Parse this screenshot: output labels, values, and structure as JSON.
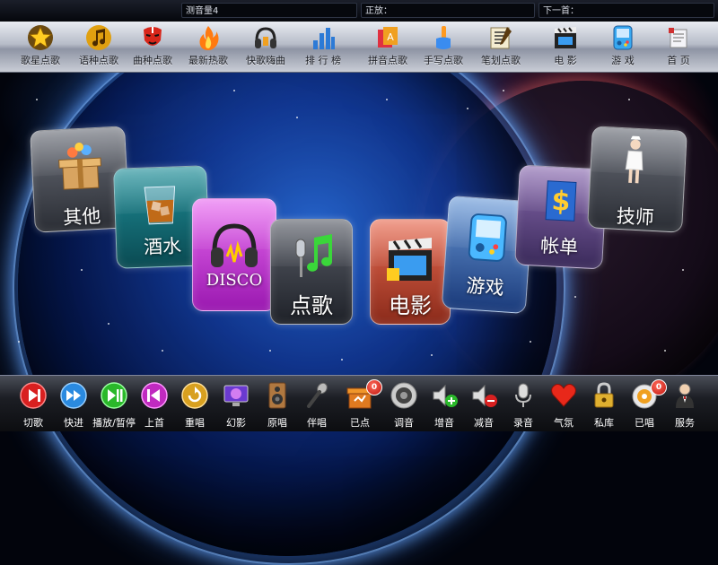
{
  "infobar": {
    "volume_text": "测音量4",
    "now_playing_label": "正放：",
    "next_label": "下一首："
  },
  "topnav": {
    "items": [
      {
        "label": "歌星点歌",
        "icon": "star-icon"
      },
      {
        "label": "语种点歌",
        "icon": "music-note-icon"
      },
      {
        "label": "曲种点歌",
        "icon": "opera-mask-icon"
      },
      {
        "label": "最新热歌",
        "icon": "flame-icon"
      },
      {
        "label": "快歌嗨曲",
        "icon": "headphones-icon"
      },
      {
        "label": "排 行 榜",
        "icon": "bar-chart-icon"
      },
      {
        "label": "拼音点歌",
        "icon": "letter-blocks-icon"
      },
      {
        "label": "手写点歌",
        "icon": "hand-pen-icon"
      },
      {
        "label": "笔划点歌",
        "icon": "brush-script-icon"
      },
      {
        "label": "电 影",
        "icon": "clapperboard-icon"
      },
      {
        "label": "游 戏",
        "icon": "gamepad-icon"
      },
      {
        "label": "首 页",
        "icon": "home-icon"
      }
    ]
  },
  "tiles": {
    "other": "其他",
    "drinks": "酒水",
    "disco": "DISCO",
    "songs": "点歌",
    "movies": "电影",
    "games": "游戏",
    "bill": "帐单",
    "technician": "技师"
  },
  "bottombar": {
    "items": [
      {
        "label": "切歌",
        "icon": "skip-icon"
      },
      {
        "label": "快进",
        "icon": "fast-forward-icon"
      },
      {
        "label": "播放/暂停",
        "icon": "play-pause-icon"
      },
      {
        "label": "上首",
        "icon": "previous-icon"
      },
      {
        "label": "重唱",
        "icon": "replay-icon"
      },
      {
        "label": "幻影",
        "icon": "screen-icon"
      },
      {
        "label": "原唱",
        "icon": "speaker-icon"
      },
      {
        "label": "伴唱",
        "icon": "microphone-icon"
      },
      {
        "label": "已点",
        "icon": "selected-songs-icon",
        "badge": "0"
      },
      {
        "label": "调音",
        "icon": "tuning-speaker-icon"
      },
      {
        "label": "增音",
        "icon": "volume-up-icon"
      },
      {
        "label": "减音",
        "icon": "volume-down-icon"
      },
      {
        "label": "录音",
        "icon": "record-mic-icon"
      },
      {
        "label": "气氛",
        "icon": "heart-icon"
      },
      {
        "label": "私库",
        "icon": "lock-icon"
      },
      {
        "label": "已唱",
        "icon": "sung-songs-icon",
        "badge": "0"
      },
      {
        "label": "服务",
        "icon": "waiter-icon"
      }
    ]
  }
}
